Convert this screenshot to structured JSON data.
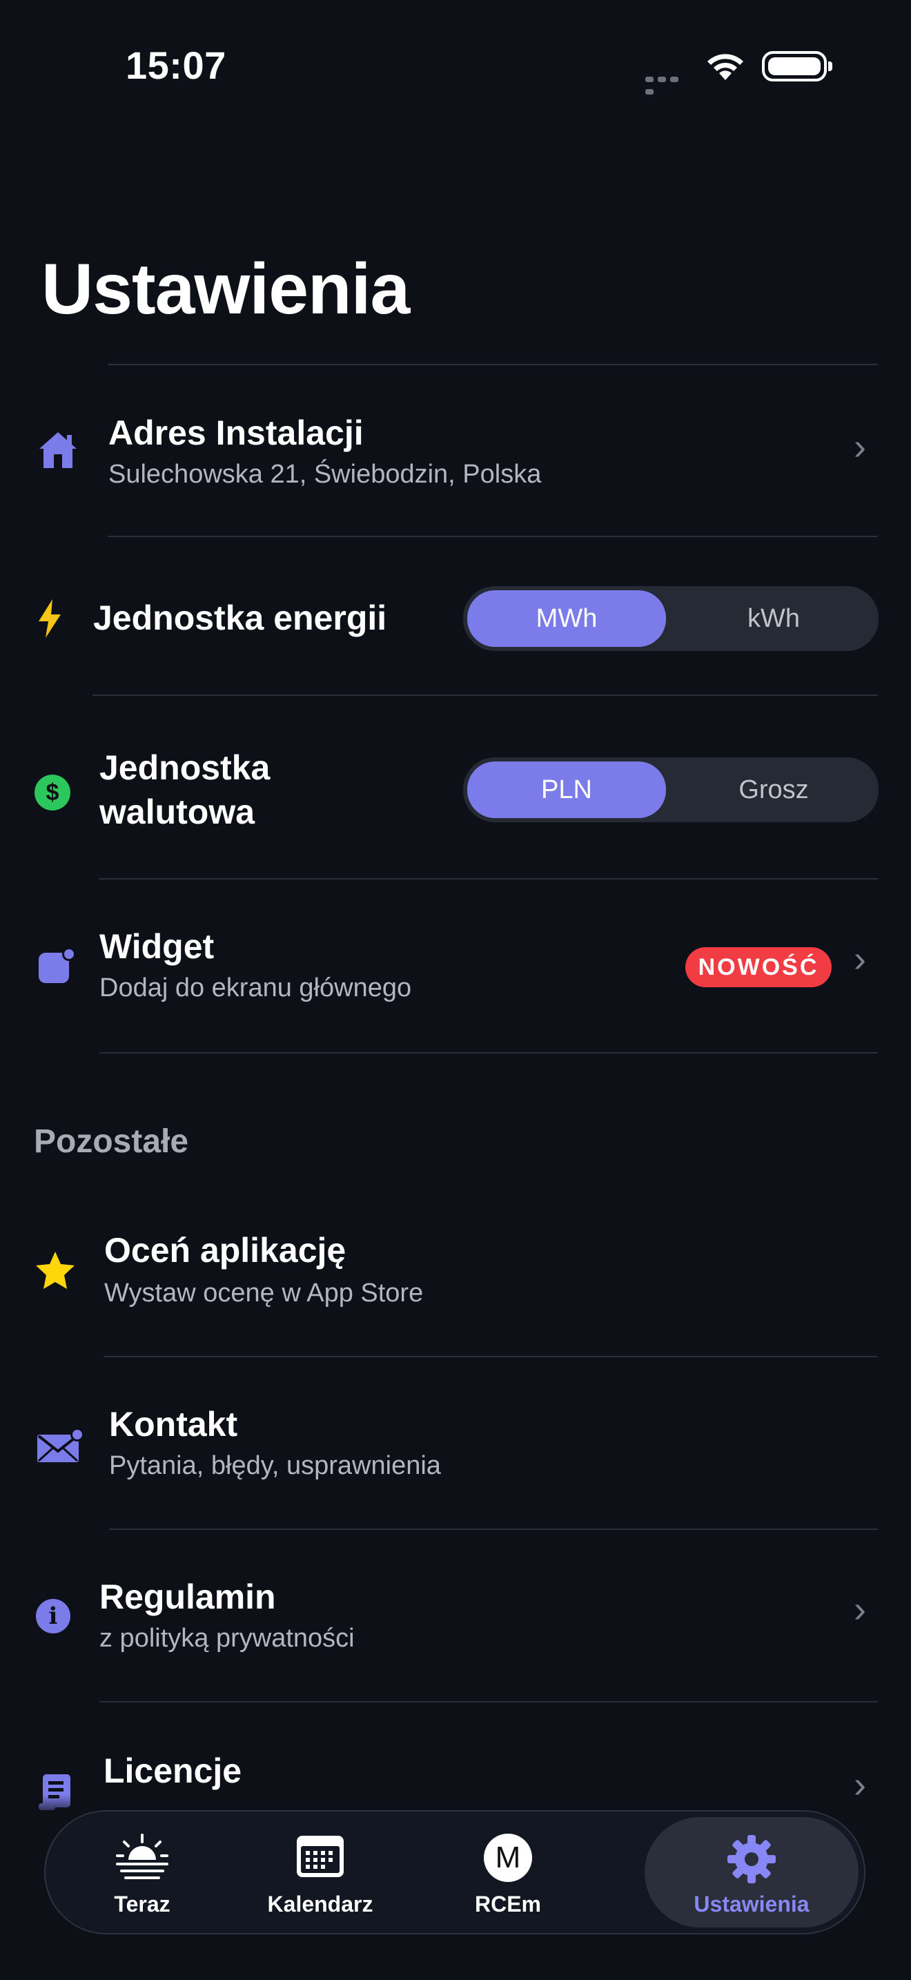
{
  "status_bar": {
    "time": "15:07"
  },
  "page": {
    "title": "Ustawienia"
  },
  "rows": {
    "address": {
      "title": "Adres Instalacji",
      "subtitle": "Sulechowska 21, Świebodzin, Polska"
    },
    "energy_unit": {
      "title": "Jednostka energii",
      "options": [
        "MWh",
        "kWh"
      ],
      "selected": "MWh"
    },
    "currency_unit": {
      "title_line1": "Jednostka",
      "title_line2": "walutowa",
      "options": [
        "PLN",
        "Grosz"
      ],
      "selected": "PLN"
    },
    "widget": {
      "title": "Widget",
      "subtitle": "Dodaj do ekranu głównego",
      "badge": "NOWOŚĆ"
    }
  },
  "section": {
    "title": "Pozostałe"
  },
  "other_rows": {
    "rate": {
      "title": "Oceń aplikację",
      "subtitle": "Wystaw ocenę w App Store"
    },
    "contact": {
      "title": "Kontakt",
      "subtitle": "Pytania, błędy, usprawnienia"
    },
    "terms": {
      "title": "Regulamin",
      "subtitle": "z polityką prywatności"
    },
    "licenses": {
      "title": "Licencje"
    }
  },
  "tabbar": {
    "tabs": [
      {
        "label": "Teraz",
        "icon": "sunrise-icon"
      },
      {
        "label": "Kalendarz",
        "icon": "calendar-icon"
      },
      {
        "label": "RCEm",
        "icon": "m-circle-icon",
        "glyph": "M"
      },
      {
        "label": "Ustawienia",
        "icon": "gear-icon"
      }
    ],
    "active": "Ustawienia"
  },
  "colors": {
    "background": "#0d1017",
    "accent": "#7b7bea",
    "badge": "#f23c43",
    "bolt": "#f5c518",
    "dollar": "#2bc65c",
    "star": "#ffd60a"
  }
}
